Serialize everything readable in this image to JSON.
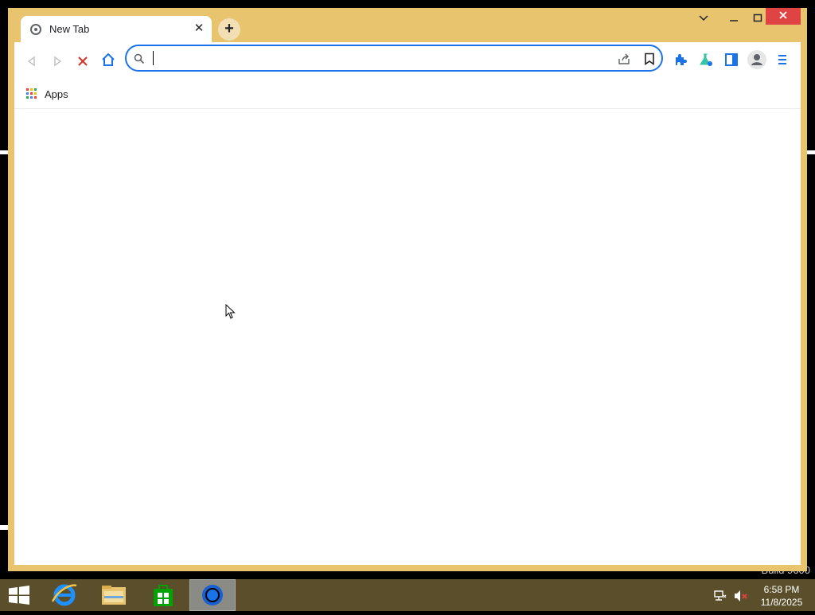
{
  "browser": {
    "tab": {
      "title": "New Tab",
      "close_glyph": "✕"
    },
    "new_tab_glyph": "+",
    "window_controls": {
      "dropdown": "⌄",
      "minimize": "–",
      "maximize": "▢",
      "close": "✕"
    },
    "omnibox": {
      "value": "",
      "placeholder": ""
    },
    "bookmarks": {
      "apps_label": "Apps"
    },
    "colors": {
      "frame": "#e8c46f",
      "accent": "#1a73e8",
      "close": "#e04343",
      "stop": "#d93025"
    }
  },
  "taskbar": {
    "apps": [
      "start-icon",
      "internet-explorer-icon",
      "file-explorer-icon",
      "store-icon",
      "chrome-icon"
    ],
    "active_app": "chrome-icon",
    "clock": {
      "time": "6:58 PM",
      "date": "11/8/2025"
    }
  },
  "desktop": {
    "watermark": "Build 9600"
  }
}
